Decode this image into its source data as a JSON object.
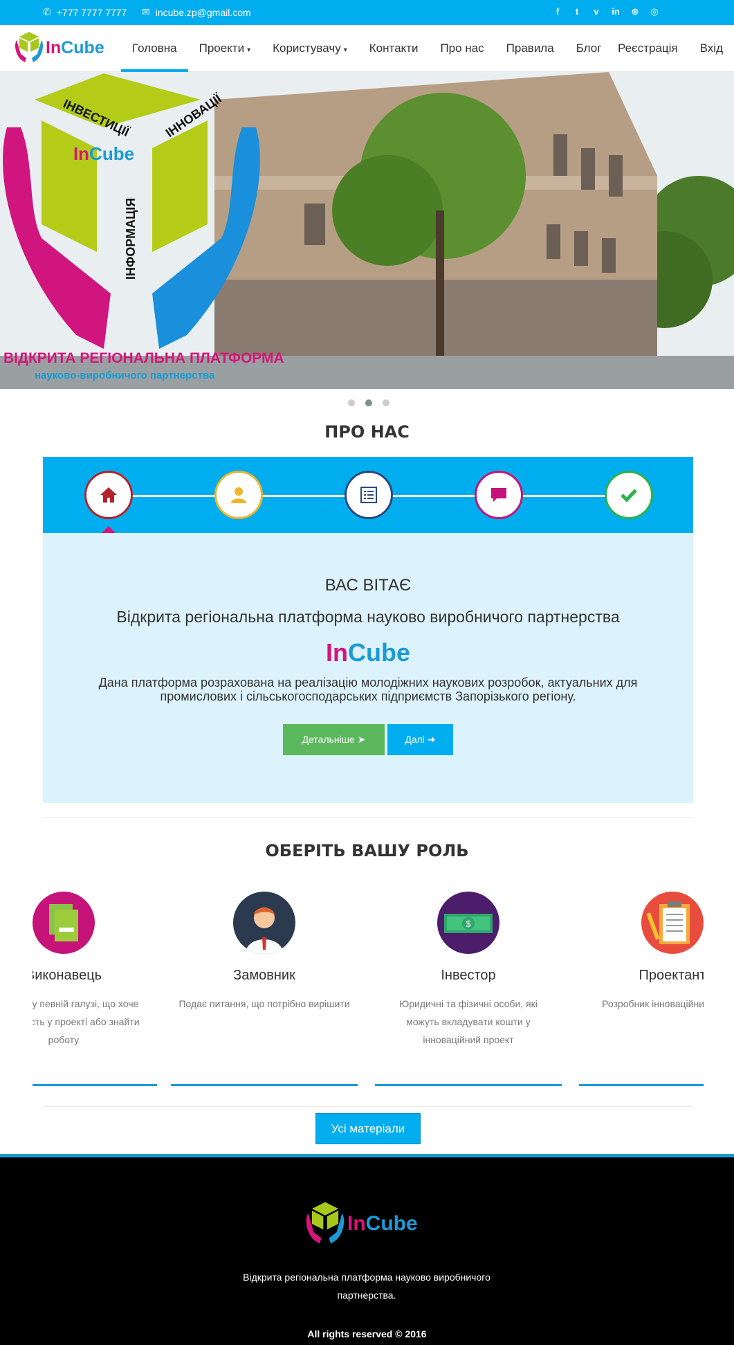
{
  "topbar": {
    "phone": "+777 7777 7777",
    "email": "incube.zp@gmail.com",
    "socials": [
      "facebook-icon",
      "twitter-icon",
      "vimeo-icon",
      "linkedin-icon",
      "dribbble-icon",
      "instagram-icon"
    ],
    "social_glyphs": [
      "f",
      "t",
      "v",
      "in",
      "⊛",
      "◎"
    ]
  },
  "brand": {
    "in": "In",
    "cube": "Cube"
  },
  "nav": {
    "items": [
      {
        "label": "Головна",
        "active": true
      },
      {
        "label": "Проекти",
        "caret": "▾"
      },
      {
        "label": "Користувачу",
        "caret": "▾"
      },
      {
        "label": "Контакти"
      },
      {
        "label": "Про нас"
      },
      {
        "label": "Правила"
      },
      {
        "label": "Блог"
      }
    ],
    "register": "Реєстрація",
    "login": "Вхід"
  },
  "hero": {
    "words": [
      "ІНВЕСТИЦІЇ",
      "ІННОВАЦІЇ",
      "ІНФОРМАЦІЯ"
    ],
    "platform": "ВІДКРИТА РЕГІОНАЛЬНА ПЛАТФОРМА",
    "platform_sub": "науково-виробничого партнерства",
    "slide_count": 3,
    "active_slide": 2
  },
  "about": {
    "title": "ПРО НАС",
    "steps": [
      {
        "icon": "home-icon",
        "color": "#b5222b"
      },
      {
        "icon": "user-icon",
        "color": "#f0b429"
      },
      {
        "icon": "list-icon",
        "color": "#2a4a7f"
      },
      {
        "icon": "comment-icon",
        "color": "#c5137a"
      },
      {
        "icon": "check-icon",
        "color": "#2db24a"
      }
    ],
    "welcome": "ВАС ВІТАЄ",
    "subtitle": "Відкрита регіональна платформа науково виробничого партнерства",
    "brand_in": "In",
    "brand_cube": "Cube",
    "description": "Дана платформа розрахована на реалізацію молодіжних наукових розробок, актуальних для промислових і сільськогосподарських підприємств Запорізького регіону.",
    "btn_details": "Детальніше",
    "btn_next": "Далі"
  },
  "roles": {
    "title": "ОБЕРІТЬ ВАШУ РОЛЬ",
    "items": [
      {
        "title": "Виконавець",
        "desc": "Фахівець у певній галузі, що хоче взяти участь у проекті або знайти роботу",
        "icon": "resume-icon",
        "color": "#c5137a"
      },
      {
        "title": "Замовник",
        "desc": "Подає питання, що потрібно вирішити",
        "icon": "businessman-icon",
        "color": "#2b3a4f"
      },
      {
        "title": "Інвестор",
        "desc": "Юридичні та фізичні особи, які можуть вкладувати кошти у інноваційний проект",
        "icon": "money-icon",
        "color": "#4b1d6b"
      },
      {
        "title": "Проектант",
        "desc": "Розробник інноваційних рішень",
        "icon": "clipboard-icon",
        "color": "#e84c3d"
      }
    ],
    "all_materials": "Усі матеріали"
  },
  "footer": {
    "text": "Відкрита регіональна платформа науково виробничого партнерства.",
    "copyright": "All rights reserved © 2016"
  }
}
